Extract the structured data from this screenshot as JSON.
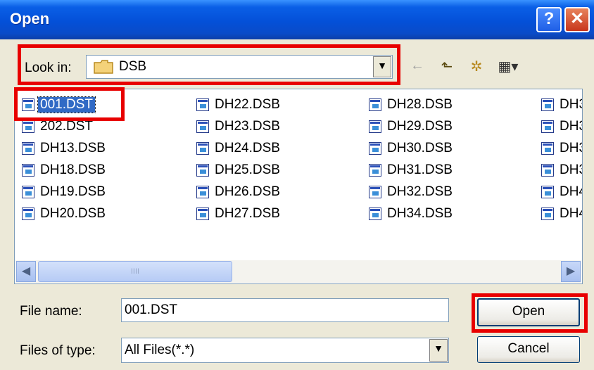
{
  "window": {
    "title": "Open",
    "help_glyph": "?",
    "close_glyph": "✕"
  },
  "toolbar": {
    "look_in_label": "Look in:",
    "look_in_value": "DSB",
    "dropdown_arrow": "▼",
    "back_icon": "←",
    "up_icon": "⬑",
    "new_folder_icon": "✲",
    "view_icon": "▦▾"
  },
  "files": [
    [
      "001.DST",
      "202.DST",
      "DH13.DSB",
      "DH18.DSB",
      "DH19.DSB",
      "DH20.DSB"
    ],
    [
      "DH22.DSB",
      "DH23.DSB",
      "DH24.DSB",
      "DH25.DSB",
      "DH26.DSB",
      "DH27.DSB"
    ],
    [
      "DH28.DSB",
      "DH29.DSB",
      "DH30.DSB",
      "DH31.DSB",
      "DH32.DSB",
      "DH34.DSB"
    ],
    [
      "DH3",
      "DH3",
      "DH3",
      "DH3",
      "DH4",
      "DH4"
    ]
  ],
  "selected_file": "001.DST",
  "scrollbar": {
    "left_arrow": "◀",
    "right_arrow": "▶",
    "grip": "IIII"
  },
  "form": {
    "filename_label": "File name:",
    "filename_value": "001.DST",
    "filetype_label": "Files of type:",
    "filetype_value": "All Files(*.*)"
  },
  "buttons": {
    "open": "Open",
    "cancel": "Cancel"
  }
}
